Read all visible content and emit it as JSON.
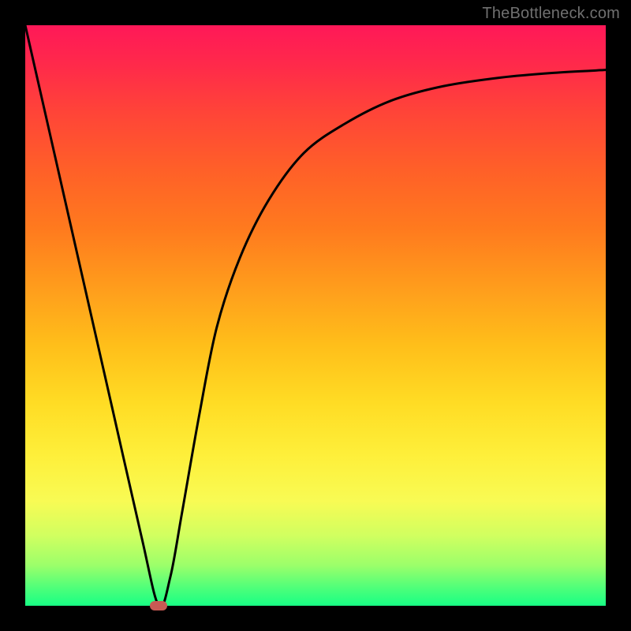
{
  "watermark": "TheBottleneck.com",
  "chart_data": {
    "type": "line",
    "title": "",
    "xlabel": "",
    "ylabel": "",
    "xlim": [
      0,
      100
    ],
    "ylim": [
      0,
      100
    ],
    "grid": false,
    "series": [
      {
        "name": "curve",
        "x": [
          0,
          5,
          10,
          15,
          20,
          23,
          25,
          27,
          30,
          33,
          37,
          42,
          48,
          55,
          63,
          72,
          82,
          91,
          100
        ],
        "y": [
          100,
          78,
          56,
          34,
          12,
          0,
          5,
          16,
          33,
          48,
          60,
          70,
          78,
          83,
          87,
          89.5,
          91,
          91.8,
          92.3
        ],
        "color": "#000000"
      }
    ],
    "marker": {
      "x": 23,
      "y": 0,
      "color": "#c85a54"
    }
  }
}
